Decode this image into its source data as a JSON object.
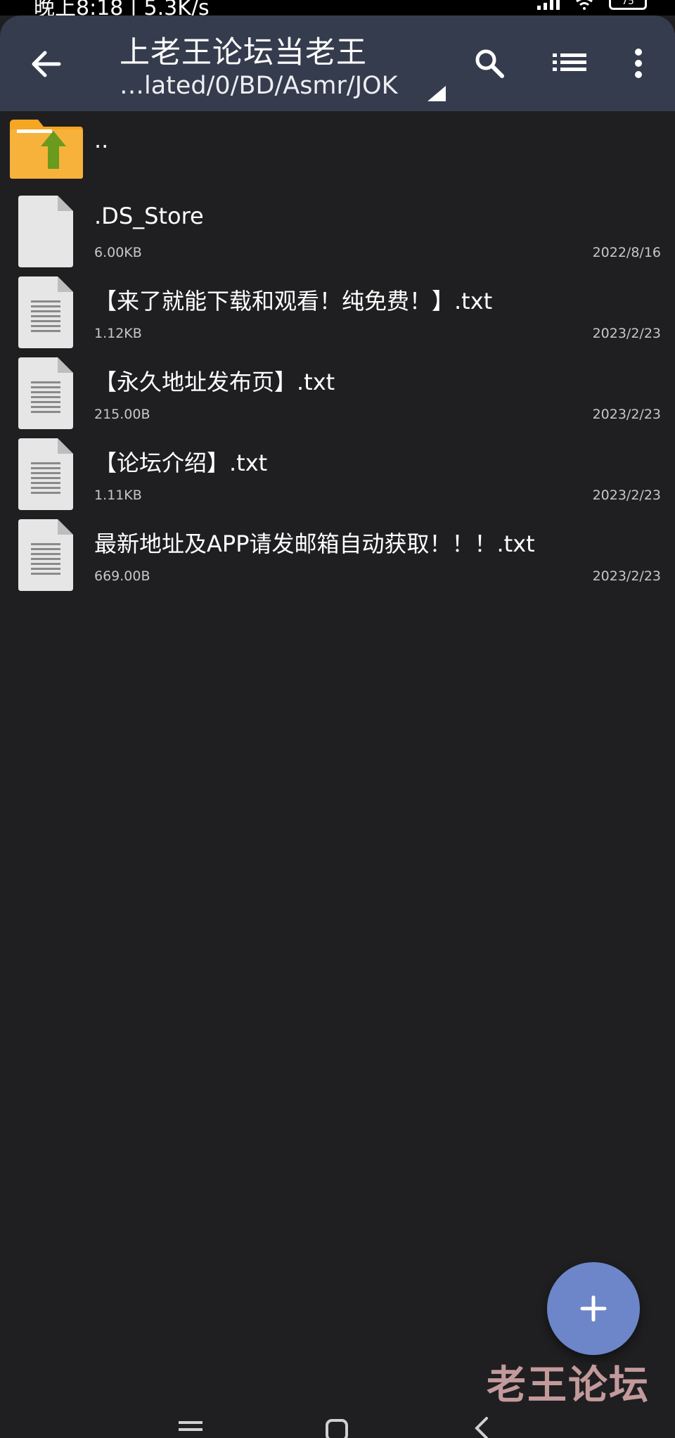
{
  "status_bar": {
    "text": "晚上8:18 | 5.3K/s",
    "battery": "75"
  },
  "header": {
    "title": "上老王论坛当老王",
    "path": "…lated/0/BD/Asmr/JOK"
  },
  "parent_item": {
    "label": ".."
  },
  "files": [
    {
      "name": ".DS_Store",
      "size": "6.00KB",
      "date": "2022/8/16",
      "icon": "blank-file-icon"
    },
    {
      "name": "【来了就能下载和观看！纯免费！】.txt",
      "size": "1.12KB",
      "date": "2023/2/23",
      "icon": "text-file-icon"
    },
    {
      "name": "【永久地址发布页】.txt",
      "size": "215.00B",
      "date": "2023/2/23",
      "icon": "text-file-icon"
    },
    {
      "name": "【论坛介绍】.txt",
      "size": "1.11KB",
      "date": "2023/2/23",
      "icon": "text-file-icon"
    },
    {
      "name": "最新地址及APP请发邮箱自动获取！！！.txt",
      "size": "669.00B",
      "date": "2023/2/23",
      "icon": "text-file-icon"
    }
  ],
  "fab": {
    "label": "+"
  },
  "watermark": "老王论坛",
  "colors": {
    "background": "#1f1f21",
    "appbar": "#353c4d",
    "fab": "#6d86c9",
    "folder": "#f5a623",
    "arrow": "#6a9a1e"
  }
}
